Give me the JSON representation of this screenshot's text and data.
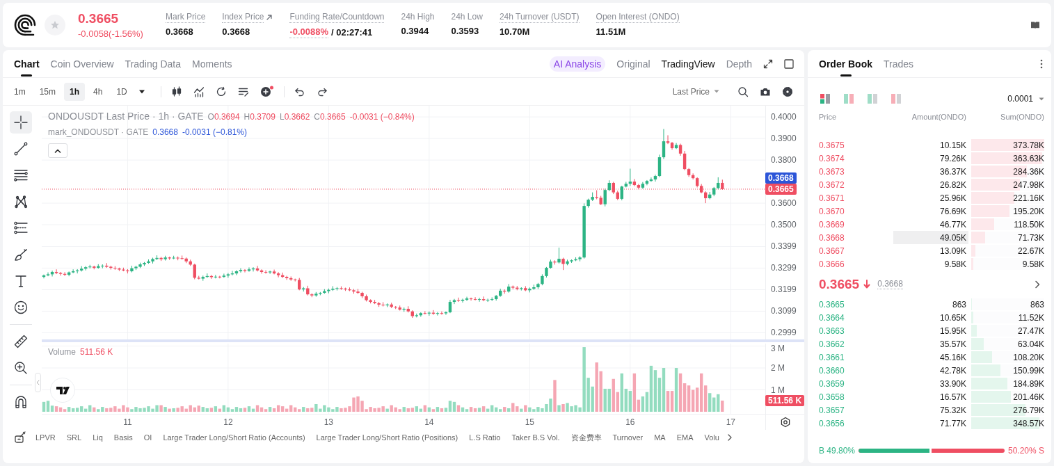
{
  "header": {
    "starred": false,
    "price": {
      "value": "0.3665",
      "change": "-0.0058(-1.56%)",
      "falling": true
    },
    "stats": [
      {
        "label": "Mark Price",
        "dotted": true,
        "kind": "plain",
        "value": "0.3668"
      },
      {
        "label": "Index Price",
        "dotted": true,
        "kind": "link",
        "value": "0.3668"
      },
      {
        "label": "Funding Rate/Countdown",
        "dotted": true,
        "kind": "funding",
        "value": "-0.0088%",
        "negative": true,
        "countdown": "/ 02:27:41"
      },
      {
        "label": "24h High",
        "dotted": false,
        "kind": "plain",
        "value": "0.3944"
      },
      {
        "label": "24h Low",
        "dotted": false,
        "kind": "plain",
        "value": "0.3593"
      },
      {
        "label": "24h Turnover (USDT)",
        "dotted": true,
        "kind": "plain",
        "value": "10.70M"
      },
      {
        "label": "Open Interest (ONDO)",
        "dotted": true,
        "kind": "plain",
        "value": "11.51M"
      }
    ]
  },
  "chart_panel": {
    "tabs": [
      {
        "label": "Chart",
        "selected": true
      },
      {
        "label": "Coin Overview",
        "selected": false
      },
      {
        "label": "Trading Data",
        "selected": false
      },
      {
        "label": "Moments",
        "selected": false
      }
    ],
    "views": [
      {
        "label": "AI Analysis",
        "kind": "ai",
        "selected": false
      },
      {
        "label": "Original",
        "kind": "plain",
        "selected": false
      },
      {
        "label": "TradingView",
        "kind": "plain",
        "selected": true
      },
      {
        "label": "Depth",
        "kind": "plain",
        "selected": false
      }
    ],
    "intervals": [
      {
        "label": "1m",
        "selected": false
      },
      {
        "label": "15m",
        "selected": false
      },
      {
        "label": "1h",
        "selected": true
      },
      {
        "label": "4h",
        "selected": false
      },
      {
        "label": "1D",
        "selected": false
      }
    ],
    "price_source": "Last Price",
    "tool_groups": [
      [
        {
          "kind": "crosshair",
          "selected": true
        },
        {
          "kind": "trend-line",
          "selected": false
        },
        {
          "kind": "horizontal-lines",
          "selected": false
        },
        {
          "kind": "pattern",
          "selected": false
        },
        {
          "kind": "fib",
          "selected": false
        },
        {
          "kind": "brush",
          "selected": false
        },
        {
          "kind": "text",
          "selected": false
        },
        {
          "kind": "emoji",
          "selected": false
        }
      ],
      [
        {
          "kind": "ruler",
          "selected": false
        },
        {
          "kind": "zoom-in",
          "selected": false
        }
      ],
      [
        {
          "kind": "magnet",
          "selected": false
        }
      ]
    ],
    "legend": {
      "title": "ONDOUSDT Last Price · 1h · GATE",
      "ohlc": [
        {
          "key": "O",
          "value": "0.3694"
        },
        {
          "key": "H",
          "value": "0.3709"
        },
        {
          "key": "L",
          "value": "0.3662"
        },
        {
          "key": "C",
          "value": "0.3665"
        }
      ],
      "change": "-0.0031 (−0.84%)",
      "falling": true,
      "mark": {
        "title": "mark_ONDOUSDT · GATE",
        "value": "0.3668",
        "change": "-0.0031 (−0.81%)"
      }
    },
    "price_chart": {
      "chart_data": {
        "type": "candlestick",
        "x": [
          10.1667,
          10.2083,
          10.25,
          10.2917,
          10.3333,
          10.375,
          10.4167,
          10.4583,
          10.5,
          10.5417,
          10.5833,
          10.625,
          10.6667,
          10.7083,
          10.75,
          10.7917,
          10.8333,
          10.875,
          10.9167,
          10.9583,
          11,
          11.0417,
          11.0833,
          11.125,
          11.1667,
          11.2083,
          11.25,
          11.2917,
          11.3333,
          11.375,
          11.4167,
          11.4583,
          11.5,
          11.5417,
          11.5833,
          11.625,
          11.6667,
          11.7083,
          11.75,
          11.7917,
          11.8333,
          11.875,
          11.9167,
          11.9583,
          12,
          12.0417,
          12.0833,
          12.125,
          12.1667,
          12.2083,
          12.25,
          12.2917,
          12.3333,
          12.375,
          12.4167,
          12.4583,
          12.5,
          12.5417,
          12.5833,
          12.625,
          12.6667,
          12.7083,
          12.75,
          12.7917,
          12.8333,
          12.875,
          12.9167,
          12.9583,
          13,
          13.0417,
          13.0833,
          13.125,
          13.1667,
          13.2083,
          13.25,
          13.2917,
          13.3333,
          13.375,
          13.4167,
          13.4583,
          13.5,
          13.5417,
          13.5833,
          13.625,
          13.6667,
          13.7083,
          13.75,
          13.7917,
          13.8333,
          13.875,
          13.9167,
          13.9583,
          14,
          14.0417,
          14.0833,
          14.125,
          14.1667,
          14.2083,
          14.25,
          14.2917,
          14.3333,
          14.375,
          14.4167,
          14.4583,
          14.5,
          14.5417,
          14.5833,
          14.625,
          14.6667,
          14.7083,
          14.75,
          14.7917,
          14.8333,
          14.875,
          14.9167,
          14.9583,
          15,
          15.0417,
          15.0833,
          15.125,
          15.1667,
          15.2083,
          15.25,
          15.2917,
          15.3333,
          15.375,
          15.4167,
          15.4583,
          15.5,
          15.5417,
          15.5833,
          15.625,
          15.6667,
          15.7083,
          15.75,
          15.7917,
          15.8333,
          15.875,
          15.9167,
          15.9583,
          16,
          16.0417,
          16.0833,
          16.125,
          16.1667,
          16.2083,
          16.25,
          16.2917,
          16.3333,
          16.375,
          16.4167,
          16.4583,
          16.5,
          16.5417,
          16.5833,
          16.625,
          16.6667,
          16.7083,
          16.75,
          16.7917,
          16.8333,
          16.875,
          16.9167
        ],
        "ohlc": [
          [
            0.3258,
            0.3269,
            0.3251,
            0.3265
          ],
          [
            0.3265,
            0.3279,
            0.3261,
            0.327
          ],
          [
            0.327,
            0.3287,
            0.326,
            0.3281
          ],
          [
            0.3281,
            0.3293,
            0.3271,
            0.3276
          ],
          [
            0.3276,
            0.3281,
            0.3264,
            0.3272
          ],
          [
            0.3272,
            0.328,
            0.3262,
            0.3268
          ],
          [
            0.3268,
            0.3283,
            0.3261,
            0.3279
          ],
          [
            0.3279,
            0.3293,
            0.3275,
            0.3284
          ],
          [
            0.3284,
            0.3294,
            0.3274,
            0.3288
          ],
          [
            0.3288,
            0.3308,
            0.3283,
            0.3296
          ],
          [
            0.3296,
            0.3308,
            0.3288,
            0.3303
          ],
          [
            0.3303,
            0.3314,
            0.3297,
            0.3306
          ],
          [
            0.3306,
            0.331,
            0.3293,
            0.33
          ],
          [
            0.33,
            0.3317,
            0.3296,
            0.3308
          ],
          [
            0.3308,
            0.3316,
            0.3298,
            0.331
          ],
          [
            0.331,
            0.3322,
            0.33,
            0.3305
          ],
          [
            0.3305,
            0.331,
            0.3292,
            0.33
          ],
          [
            0.33,
            0.3308,
            0.3291,
            0.3297
          ],
          [
            0.3297,
            0.3301,
            0.3285,
            0.3292
          ],
          [
            0.3292,
            0.3301,
            0.3284,
            0.3288
          ],
          [
            0.3288,
            0.3294,
            0.3274,
            0.3284
          ],
          [
            0.3284,
            0.331,
            0.3279,
            0.3298
          ],
          [
            0.3298,
            0.331,
            0.329,
            0.3305
          ],
          [
            0.3305,
            0.3324,
            0.3299,
            0.3316
          ],
          [
            0.3316,
            0.3327,
            0.3309,
            0.3323
          ],
          [
            0.3323,
            0.3339,
            0.3319,
            0.333
          ],
          [
            0.333,
            0.3347,
            0.332,
            0.3341
          ],
          [
            0.3341,
            0.3358,
            0.3336,
            0.3346
          ],
          [
            0.3346,
            0.3351,
            0.3332,
            0.334
          ],
          [
            0.334,
            0.3356,
            0.3334,
            0.3348
          ],
          [
            0.3348,
            0.3352,
            0.3337,
            0.3344
          ],
          [
            0.3344,
            0.3356,
            0.334,
            0.3347
          ],
          [
            0.3347,
            0.3353,
            0.3335,
            0.3345
          ],
          [
            0.3345,
            0.3357,
            0.3338,
            0.3343
          ],
          [
            0.3343,
            0.3348,
            0.3322,
            0.333
          ],
          [
            0.333,
            0.3338,
            0.3309,
            0.3315
          ],
          [
            0.3315,
            0.3319,
            0.3247,
            0.3254
          ],
          [
            0.3254,
            0.3263,
            0.3246,
            0.325
          ],
          [
            0.325,
            0.3264,
            0.324,
            0.3258
          ],
          [
            0.3258,
            0.3274,
            0.3253,
            0.3262
          ],
          [
            0.3262,
            0.3267,
            0.3249,
            0.3257
          ],
          [
            0.3257,
            0.3267,
            0.3251,
            0.3259
          ],
          [
            0.3259,
            0.3263,
            0.3251,
            0.3258
          ],
          [
            0.3258,
            0.3273,
            0.3254,
            0.3264
          ],
          [
            0.3264,
            0.3276,
            0.3254,
            0.327
          ],
          [
            0.327,
            0.3286,
            0.3265,
            0.3274
          ],
          [
            0.3274,
            0.3289,
            0.3266,
            0.3284
          ],
          [
            0.3284,
            0.3298,
            0.3278,
            0.329
          ],
          [
            0.329,
            0.3294,
            0.3279,
            0.3286
          ],
          [
            0.3286,
            0.3302,
            0.3282,
            0.3293
          ],
          [
            0.3293,
            0.3303,
            0.3283,
            0.3297
          ],
          [
            0.3297,
            0.3309,
            0.3283,
            0.3288
          ],
          [
            0.3288,
            0.3293,
            0.3273,
            0.3281
          ],
          [
            0.3281,
            0.3289,
            0.3273,
            0.3279
          ],
          [
            0.3279,
            0.3287,
            0.3272,
            0.3283
          ],
          [
            0.3283,
            0.3292,
            0.327,
            0.3274
          ],
          [
            0.3274,
            0.328,
            0.3256,
            0.3266
          ],
          [
            0.3266,
            0.3278,
            0.3253,
            0.3258
          ],
          [
            0.3258,
            0.3263,
            0.3244,
            0.3252
          ],
          [
            0.3252,
            0.326,
            0.324,
            0.3246
          ],
          [
            0.3246,
            0.325,
            0.3237,
            0.3244
          ],
          [
            0.3244,
            0.3253,
            0.3196,
            0.32
          ],
          [
            0.32,
            0.3211,
            0.319,
            0.3205
          ],
          [
            0.3205,
            0.3217,
            0.3172,
            0.3177
          ],
          [
            0.3177,
            0.3182,
            0.3164,
            0.3172
          ],
          [
            0.3172,
            0.3188,
            0.3166,
            0.318
          ],
          [
            0.318,
            0.3188,
            0.3173,
            0.3184
          ],
          [
            0.3184,
            0.3201,
            0.318,
            0.3192
          ],
          [
            0.3192,
            0.3204,
            0.3182,
            0.3198
          ],
          [
            0.3198,
            0.3215,
            0.3193,
            0.3203
          ],
          [
            0.3203,
            0.3211,
            0.3195,
            0.3206
          ],
          [
            0.3206,
            0.3214,
            0.3198,
            0.3204
          ],
          [
            0.3204,
            0.3208,
            0.3193,
            0.32
          ],
          [
            0.32,
            0.3209,
            0.3192,
            0.3196
          ],
          [
            0.3196,
            0.3202,
            0.318,
            0.319
          ],
          [
            0.319,
            0.3202,
            0.3179,
            0.3184
          ],
          [
            0.3184,
            0.3189,
            0.316,
            0.3168
          ],
          [
            0.3168,
            0.3176,
            0.3144,
            0.315
          ],
          [
            0.315,
            0.3154,
            0.3135,
            0.3142
          ],
          [
            0.3142,
            0.3151,
            0.3132,
            0.3136
          ],
          [
            0.3136,
            0.3142,
            0.3119,
            0.3129
          ],
          [
            0.3129,
            0.3141,
            0.3121,
            0.3126
          ],
          [
            0.3126,
            0.3135,
            0.3118,
            0.313
          ],
          [
            0.313,
            0.3138,
            0.3113,
            0.3119
          ],
          [
            0.3119,
            0.3123,
            0.3109,
            0.3116
          ],
          [
            0.3116,
            0.3125,
            0.3102,
            0.3106
          ],
          [
            0.3106,
            0.3116,
            0.3096,
            0.311
          ],
          [
            0.311,
            0.3122,
            0.3093,
            0.3098
          ],
          [
            0.3098,
            0.3103,
            0.3068,
            0.3076
          ],
          [
            0.3076,
            0.3088,
            0.307,
            0.308
          ],
          [
            0.308,
            0.3094,
            0.3073,
            0.309
          ],
          [
            0.309,
            0.3099,
            0.3084,
            0.3088
          ],
          [
            0.3088,
            0.3098,
            0.3078,
            0.3092
          ],
          [
            0.3092,
            0.3104,
            0.3082,
            0.3087
          ],
          [
            0.3087,
            0.3095,
            0.3079,
            0.309
          ],
          [
            0.309,
            0.3098,
            0.3083,
            0.3089
          ],
          [
            0.3089,
            0.3098,
            0.3082,
            0.3094
          ],
          [
            0.3094,
            0.3151,
            0.309,
            0.3142
          ],
          [
            0.3142,
            0.3156,
            0.3132,
            0.315
          ],
          [
            0.315,
            0.3162,
            0.3142,
            0.3147
          ],
          [
            0.3147,
            0.3157,
            0.3139,
            0.3152
          ],
          [
            0.3152,
            0.3166,
            0.3146,
            0.3158
          ],
          [
            0.3158,
            0.3162,
            0.3148,
            0.3155
          ],
          [
            0.3155,
            0.3164,
            0.3149,
            0.3153
          ],
          [
            0.3153,
            0.3161,
            0.3143,
            0.3155
          ],
          [
            0.3155,
            0.3167,
            0.3145,
            0.315
          ],
          [
            0.315,
            0.3157,
            0.3142,
            0.3152
          ],
          [
            0.3152,
            0.3163,
            0.3146,
            0.3155
          ],
          [
            0.3155,
            0.3174,
            0.3148,
            0.317
          ],
          [
            0.317,
            0.3203,
            0.3166,
            0.3194
          ],
          [
            0.3194,
            0.32,
            0.318,
            0.319
          ],
          [
            0.319,
            0.3225,
            0.3185,
            0.3213
          ],
          [
            0.3213,
            0.3218,
            0.32,
            0.3208
          ],
          [
            0.3208,
            0.3216,
            0.3196,
            0.3202
          ],
          [
            0.3202,
            0.321,
            0.3195,
            0.3206
          ],
          [
            0.3206,
            0.3215,
            0.3192,
            0.3196
          ],
          [
            0.3196,
            0.3209,
            0.3186,
            0.3203
          ],
          [
            0.3203,
            0.3222,
            0.3198,
            0.321
          ],
          [
            0.321,
            0.323,
            0.3202,
            0.3225
          ],
          [
            0.3225,
            0.327,
            0.3219,
            0.3262
          ],
          [
            0.3262,
            0.3304,
            0.3255,
            0.33
          ],
          [
            0.33,
            0.3338,
            0.3296,
            0.3329
          ],
          [
            0.3329,
            0.3335,
            0.3315,
            0.3325
          ],
          [
            0.3325,
            0.3394,
            0.332,
            0.3342
          ],
          [
            0.3342,
            0.3347,
            0.329,
            0.3318
          ],
          [
            0.3318,
            0.3338,
            0.3312,
            0.333
          ],
          [
            0.333,
            0.3339,
            0.3323,
            0.3335
          ],
          [
            0.3335,
            0.3349,
            0.3331,
            0.334
          ],
          [
            0.334,
            0.3354,
            0.333,
            0.3348
          ],
          [
            0.3348,
            0.3599,
            0.3343,
            0.3587
          ],
          [
            0.3587,
            0.3621,
            0.3579,
            0.3616
          ],
          [
            0.3616,
            0.365,
            0.361,
            0.3629
          ],
          [
            0.3629,
            0.366,
            0.3618,
            0.3625
          ],
          [
            0.3625,
            0.3634,
            0.3591,
            0.3595
          ],
          [
            0.3595,
            0.3667,
            0.3585,
            0.3661
          ],
          [
            0.3661,
            0.3706,
            0.3656,
            0.3694
          ],
          [
            0.3694,
            0.3699,
            0.3642,
            0.365
          ],
          [
            0.365,
            0.3658,
            0.3614,
            0.362
          ],
          [
            0.362,
            0.3681,
            0.3613,
            0.3677
          ],
          [
            0.3677,
            0.3699,
            0.3673,
            0.369
          ],
          [
            0.369,
            0.376,
            0.368,
            0.37
          ],
          [
            0.37,
            0.3712,
            0.3679,
            0.3684
          ],
          [
            0.3684,
            0.3689,
            0.3664,
            0.3672
          ],
          [
            0.3672,
            0.3698,
            0.3666,
            0.369
          ],
          [
            0.369,
            0.3707,
            0.3683,
            0.3703
          ],
          [
            0.3703,
            0.3719,
            0.3699,
            0.371
          ],
          [
            0.371,
            0.3732,
            0.37,
            0.3726
          ],
          [
            0.3726,
            0.3825,
            0.3721,
            0.3813
          ],
          [
            0.3813,
            0.3944,
            0.3805,
            0.3887
          ],
          [
            0.3887,
            0.3915,
            0.3874,
            0.388
          ],
          [
            0.388,
            0.3884,
            0.3848,
            0.3855
          ],
          [
            0.3855,
            0.3879,
            0.3851,
            0.387
          ],
          [
            0.387,
            0.3876,
            0.382,
            0.383
          ],
          [
            0.383,
            0.3842,
            0.3753,
            0.3758
          ],
          [
            0.3758,
            0.3763,
            0.3722,
            0.373
          ],
          [
            0.373,
            0.3738,
            0.371,
            0.3716
          ],
          [
            0.3716,
            0.372,
            0.3673,
            0.368
          ],
          [
            0.368,
            0.3689,
            0.3646,
            0.365
          ],
          [
            0.365,
            0.3656,
            0.36,
            0.3623
          ],
          [
            0.3623,
            0.3652,
            0.3618,
            0.364
          ],
          [
            0.364,
            0.3675,
            0.3632,
            0.367
          ],
          [
            0.367,
            0.372,
            0.3664,
            0.3694
          ],
          [
            0.3694,
            0.3709,
            0.3662,
            0.3665
          ]
        ],
        "ref_lines": [
          {
            "axis": "y",
            "value": 0.3665,
            "color": "#ef4e62"
          }
        ],
        "grid": true,
        "xlim": [
          10.1458,
          17.7314
        ],
        "ylim": [
          0.2968,
          0.4052
        ],
        "yticks": [
          {
            "value": 0.4,
            "label": "0.4000"
          },
          {
            "value": 0.39,
            "label": "0.3900"
          },
          {
            "value": 0.38,
            "label": "0.3800"
          },
          {
            "value": 0.36,
            "label": "0.3600"
          },
          {
            "value": 0.35,
            "label": "0.3500"
          },
          {
            "value": 0.3399,
            "label": "0.3399"
          },
          {
            "value": 0.3299,
            "label": "0.3299"
          },
          {
            "value": 0.3199,
            "label": "0.3199"
          },
          {
            "value": 0.3099,
            "label": "0.3099"
          },
          {
            "value": 0.2999,
            "label": "0.2999"
          }
        ]
      }
    },
    "price_tags": [
      {
        "kind": "mark",
        "value": "0.3668"
      },
      {
        "kind": "last",
        "value": "0.3665"
      }
    ],
    "volume": {
      "label": "Volume",
      "value": "511.56 K",
      "falling": true,
      "tag": "511.56 K",
      "chart_data": {
        "type": "bar",
        "x": [
          10.1667,
          10.2083,
          10.25,
          10.2917,
          10.3333,
          10.375,
          10.4167,
          10.4583,
          10.5,
          10.5417,
          10.5833,
          10.625,
          10.6667,
          10.7083,
          10.75,
          10.7917,
          10.8333,
          10.875,
          10.9167,
          10.9583,
          11,
          11.0417,
          11.0833,
          11.125,
          11.1667,
          11.2083,
          11.25,
          11.2917,
          11.3333,
          11.375,
          11.4167,
          11.4583,
          11.5,
          11.5417,
          11.5833,
          11.625,
          11.6667,
          11.7083,
          11.75,
          11.7917,
          11.8333,
          11.875,
          11.9167,
          11.9583,
          12,
          12.0417,
          12.0833,
          12.125,
          12.1667,
          12.2083,
          12.25,
          12.2917,
          12.3333,
          12.375,
          12.4167,
          12.4583,
          12.5,
          12.5417,
          12.5833,
          12.625,
          12.6667,
          12.7083,
          12.75,
          12.7917,
          12.8333,
          12.875,
          12.9167,
          12.9583,
          13,
          13.0417,
          13.0833,
          13.125,
          13.1667,
          13.2083,
          13.25,
          13.2917,
          13.3333,
          13.375,
          13.4167,
          13.4583,
          13.5,
          13.5417,
          13.5833,
          13.625,
          13.6667,
          13.7083,
          13.75,
          13.7917,
          13.8333,
          13.875,
          13.9167,
          13.9583,
          14,
          14.0417,
          14.0833,
          14.125,
          14.1667,
          14.2083,
          14.25,
          14.2917,
          14.3333,
          14.375,
          14.4167,
          14.4583,
          14.5,
          14.5417,
          14.5833,
          14.625,
          14.6667,
          14.7083,
          14.75,
          14.7917,
          14.8333,
          14.875,
          14.9167,
          14.9583,
          15,
          15.0417,
          15.0833,
          15.125,
          15.1667,
          15.2083,
          15.25,
          15.2917,
          15.3333,
          15.375,
          15.4167,
          15.4583,
          15.5,
          15.5417,
          15.5833,
          15.625,
          15.6667,
          15.7083,
          15.75,
          15.7917,
          15.8333,
          15.875,
          15.9167,
          15.9583,
          16,
          16.0417,
          16.0833,
          16.125,
          16.1667,
          16.2083,
          16.25,
          16.2917,
          16.3333,
          16.375,
          16.4167,
          16.4583,
          16.5,
          16.5417,
          16.5833,
          16.625,
          16.6667,
          16.7083,
          16.75,
          16.7917,
          16.8333,
          16.875,
          16.9167
        ],
        "values": [
          0.45,
          0.5,
          0.28,
          0.25,
          0.2,
          0.12,
          0.22,
          0.16,
          0.18,
          0.25,
          0.14,
          0.3,
          0.2,
          0.12,
          0.22,
          0.16,
          0.18,
          0.25,
          0.14,
          0.3,
          0.2,
          0.12,
          0.22,
          0.16,
          0.18,
          0.25,
          0.14,
          0.3,
          0.3,
          0.22,
          0.14,
          0.16,
          0.18,
          0.25,
          0.14,
          0.3,
          0.2,
          0.28,
          0.22,
          0.16,
          0.18,
          0.25,
          0.14,
          0.3,
          0.2,
          0.12,
          0.22,
          0.16,
          0.18,
          0.25,
          0.14,
          0.3,
          0.2,
          0.12,
          0.22,
          0.16,
          0.3,
          0.25,
          0.14,
          0.3,
          0.2,
          0.12,
          0.22,
          0.16,
          0.18,
          0.35,
          0.14,
          0.3,
          0.2,
          0.12,
          0.22,
          0.16,
          0.18,
          0.25,
          0.65,
          0.7,
          0.5,
          0.12,
          0.22,
          0.16,
          0.18,
          0.25,
          0.14,
          0.3,
          0.2,
          0.12,
          0.22,
          0.16,
          0.18,
          0.25,
          0.14,
          0.3,
          0.2,
          0.12,
          0.22,
          0.16,
          0.18,
          0.5,
          0.45,
          0.3,
          0.2,
          0.12,
          0.22,
          0.16,
          0.18,
          0.25,
          0.14,
          0.3,
          0.2,
          0.12,
          0.22,
          0.16,
          0.4,
          0.25,
          0.14,
          0.3,
          0.2,
          0.12,
          0.22,
          0.16,
          0.35,
          0.6,
          1.45,
          0.3,
          0.35,
          0.4,
          0.25,
          0.3,
          0.2,
          2.95,
          1.55,
          1.15,
          2.25,
          1.85,
          1.05,
          1.05,
          1.5,
          0.9,
          1.75,
          1.05,
          0.95,
          1.75,
          0.55,
          0.7,
          0.9,
          2.1,
          1.9,
          1.55,
          2.0,
          0.95,
          0.95,
          2.0,
          1.75,
          1.3,
          1.2,
          1.0,
          1.1,
          1.75,
          1.2,
          0.85,
          0.65,
          0.8,
          0.51
        ],
        "grid": true,
        "xlim": [
          10.1458,
          17.7314
        ],
        "ylim": [
          -0.095,
          3.111
        ],
        "yticks": [
          {
            "value": 3,
            "label": "3 M"
          },
          {
            "value": 2,
            "label": "2 M"
          },
          {
            "value": 1,
            "label": "1 M"
          }
        ],
        "xticks": [
          {
            "value": 11,
            "label": "11"
          },
          {
            "value": 12,
            "label": "12"
          },
          {
            "value": 13,
            "label": "13"
          },
          {
            "value": 14,
            "label": "14"
          },
          {
            "value": 15,
            "label": "15"
          },
          {
            "value": 16,
            "label": "16"
          },
          {
            "value": 17,
            "label": "17"
          }
        ]
      }
    },
    "indicators": [
      "LPVR",
      "SRL",
      "Liq",
      "Basis",
      "OI",
      "Large Trader Long/Short Ratio (Accounts)",
      "Large Trader Long/Short Ratio (Positions)",
      "L.S Ratio",
      "Taker B.S Vol.",
      "资金费率",
      "Turnover",
      "MA",
      "EMA",
      "Volu"
    ]
  },
  "order_book": {
    "tabs": [
      {
        "label": "Order Book",
        "selected": true
      },
      {
        "label": "Trades",
        "selected": false
      }
    ],
    "layouts": [
      {
        "kind": "stacked",
        "selected": true
      },
      {
        "kind": "split",
        "selected": false
      },
      {
        "kind": "bids-only",
        "selected": false
      },
      {
        "kind": "asks-only",
        "selected": false
      }
    ],
    "precision": "0.0001",
    "columns": [
      "Price",
      "Amount(ONDO)",
      "Sum(ONDO)"
    ],
    "asks": [
      {
        "price": "0.3675",
        "amount": "10.15K",
        "sum": "373.78K",
        "level": 1.0,
        "highlighted": false
      },
      {
        "price": "0.3674",
        "amount": "79.26K",
        "sum": "363.63K",
        "level": 0.973,
        "highlighted": false
      },
      {
        "price": "0.3673",
        "amount": "36.37K",
        "sum": "284.36K",
        "level": 0.761,
        "highlighted": false
      },
      {
        "price": "0.3672",
        "amount": "26.82K",
        "sum": "247.98K",
        "level": 0.663,
        "highlighted": false
      },
      {
        "price": "0.3671",
        "amount": "25.96K",
        "sum": "221.16K",
        "level": 0.592,
        "highlighted": false
      },
      {
        "price": "0.3670",
        "amount": "76.69K",
        "sum": "195.20K",
        "level": 0.522,
        "highlighted": false
      },
      {
        "price": "0.3669",
        "amount": "46.77K",
        "sum": "118.50K",
        "level": 0.317,
        "highlighted": false
      },
      {
        "price": "0.3668",
        "amount": "49.05K",
        "sum": "71.73K",
        "level": 0.192,
        "highlighted": true
      },
      {
        "price": "0.3667",
        "amount": "13.09K",
        "sum": "22.67K",
        "level": 0.061,
        "highlighted": false
      },
      {
        "price": "0.3666",
        "amount": "9.58K",
        "sum": "9.58K",
        "level": 0.026,
        "highlighted": false
      }
    ],
    "mid": {
      "price": "0.3665",
      "falling": true,
      "mark": "0.3668"
    },
    "bids": [
      {
        "price": "0.3665",
        "amount": "863",
        "sum": "863",
        "level": 0.002,
        "highlighted": false
      },
      {
        "price": "0.3664",
        "amount": "10.65K",
        "sum": "11.52K",
        "level": 0.031,
        "highlighted": false
      },
      {
        "price": "0.3663",
        "amount": "15.95K",
        "sum": "27.47K",
        "level": 0.073,
        "highlighted": false
      },
      {
        "price": "0.3662",
        "amount": "35.57K",
        "sum": "63.04K",
        "level": 0.169,
        "highlighted": false
      },
      {
        "price": "0.3661",
        "amount": "45.16K",
        "sum": "108.20K",
        "level": 0.289,
        "highlighted": false
      },
      {
        "price": "0.3660",
        "amount": "42.78K",
        "sum": "150.99K",
        "level": 0.404,
        "highlighted": false
      },
      {
        "price": "0.3659",
        "amount": "33.90K",
        "sum": "184.89K",
        "level": 0.495,
        "highlighted": false
      },
      {
        "price": "0.3658",
        "amount": "16.57K",
        "sum": "201.46K",
        "level": 0.539,
        "highlighted": false
      },
      {
        "price": "0.3657",
        "amount": "75.32K",
        "sum": "276.79K",
        "level": 0.741,
        "highlighted": false
      },
      {
        "price": "0.3656",
        "amount": "71.77K",
        "sum": "348.57K",
        "level": 0.933,
        "highlighted": false
      }
    ],
    "ratio": {
      "buy": "B 49.80%",
      "sell": "50.20% S",
      "level": 0.498
    }
  }
}
